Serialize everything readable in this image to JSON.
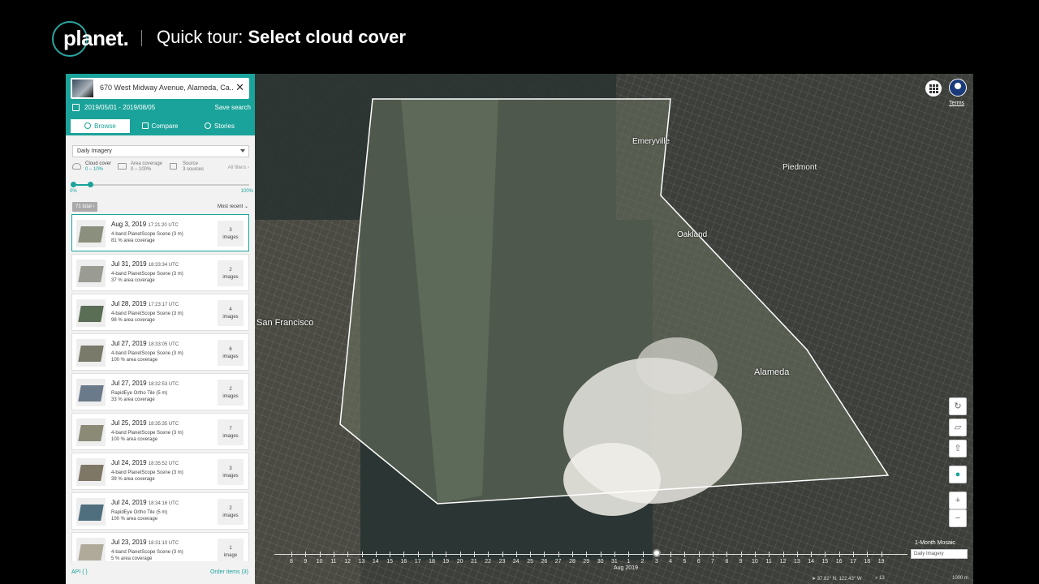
{
  "header": {
    "brand": "planet.",
    "tour_prefix": "Quick tour: ",
    "tour_title": "Select cloud cover"
  },
  "sidebar": {
    "search_value": "670 West Midway Avenue, Alameda, Ca...",
    "date_range": "2019/05/01 - 2019/08/05",
    "save_search": "Save search",
    "tabs": [
      {
        "label": "Browse",
        "icon": "eye-icon"
      },
      {
        "label": "Compare",
        "icon": "compare-icon"
      },
      {
        "label": "Stories",
        "icon": "stories-icon"
      }
    ],
    "imagery_select": "Daily Imagery",
    "filters": {
      "cloud_title": "Cloud cover",
      "cloud_value": "0 – 10%",
      "area_title": "Area coverage",
      "area_value": "0 – 100%",
      "source_title": "Source",
      "source_value": "3 sources",
      "all_filters": "All filters"
    },
    "slider": {
      "min_label": "0%",
      "max_label": "100%",
      "low": 0.0,
      "high": 0.1
    },
    "total": "71 total",
    "sort": "Most recent",
    "results": [
      {
        "date": "Aug 3, 2019",
        "time": "17:21:20 UTC",
        "type": "4-band PlanetScope Scene (3 m)",
        "coverage": "81 % area coverage",
        "count": "3",
        "unit": "images"
      },
      {
        "date": "Jul 31, 2019",
        "time": "18:33:34 UTC",
        "type": "4-band PlanetScope Scene (3 m)",
        "coverage": "37 % area coverage",
        "count": "2",
        "unit": "images"
      },
      {
        "date": "Jul 28, 2019",
        "time": "17:23:17 UTC",
        "type": "4-band PlanetScope Scene (3 m)",
        "coverage": "98 % area coverage",
        "count": "4",
        "unit": "images"
      },
      {
        "date": "Jul 27, 2019",
        "time": "18:33:05 UTC",
        "type": "4-band PlanetScope Scene (3 m)",
        "coverage": "100 % area coverage",
        "count": "6",
        "unit": "images"
      },
      {
        "date": "Jul 27, 2019",
        "time": "18:32:53 UTC",
        "type": "RapidEye Ortho Tile (5 m)",
        "coverage": "33 % area coverage",
        "count": "2",
        "unit": "images"
      },
      {
        "date": "Jul 25, 2019",
        "time": "18:35:35 UTC",
        "type": "4-band PlanetScope Scene (3 m)",
        "coverage": "100 % area coverage",
        "count": "7",
        "unit": "images"
      },
      {
        "date": "Jul 24, 2019",
        "time": "18:35:52 UTC",
        "type": "4-band PlanetScope Scene (3 m)",
        "coverage": "39 % area coverage",
        "count": "3",
        "unit": "images"
      },
      {
        "date": "Jul 24, 2019",
        "time": "18:34:16 UTC",
        "type": "RapidEye Ortho Tile (5 m)",
        "coverage": "100 % area coverage",
        "count": "2",
        "unit": "images"
      },
      {
        "date": "Jul 23, 2019",
        "time": "18:31:10 UTC",
        "type": "4-band PlanetScope Scene (3 m)",
        "coverage": "5 % area coverage",
        "count": "1",
        "unit": "image"
      }
    ],
    "api_link": "API { }",
    "order_link": "Order items (3)"
  },
  "map": {
    "labels": [
      "Emeryville",
      "Piedmont",
      "Oakland",
      "San Francisco",
      "Alameda"
    ],
    "terms": "Terms",
    "timeline_days": [
      "8",
      "9",
      "10",
      "11",
      "12",
      "13",
      "14",
      "15",
      "16",
      "17",
      "18",
      "19",
      "20",
      "21",
      "22",
      "23",
      "24",
      "25",
      "26",
      "27",
      "28",
      "29",
      "30",
      "31",
      "1",
      "2",
      "3",
      "4",
      "5",
      "6",
      "7",
      "8",
      "9",
      "10",
      "11",
      "12",
      "13",
      "14",
      "15",
      "16",
      "17",
      "18",
      "19"
    ],
    "timeline_month": "Aug 2019",
    "mosaic_label": "1-Month Mosaic",
    "imagery_label": "Daily Imagery",
    "coords": "37.82° N, 122.43° W",
    "zoom": "13",
    "scale": "1000 m"
  }
}
